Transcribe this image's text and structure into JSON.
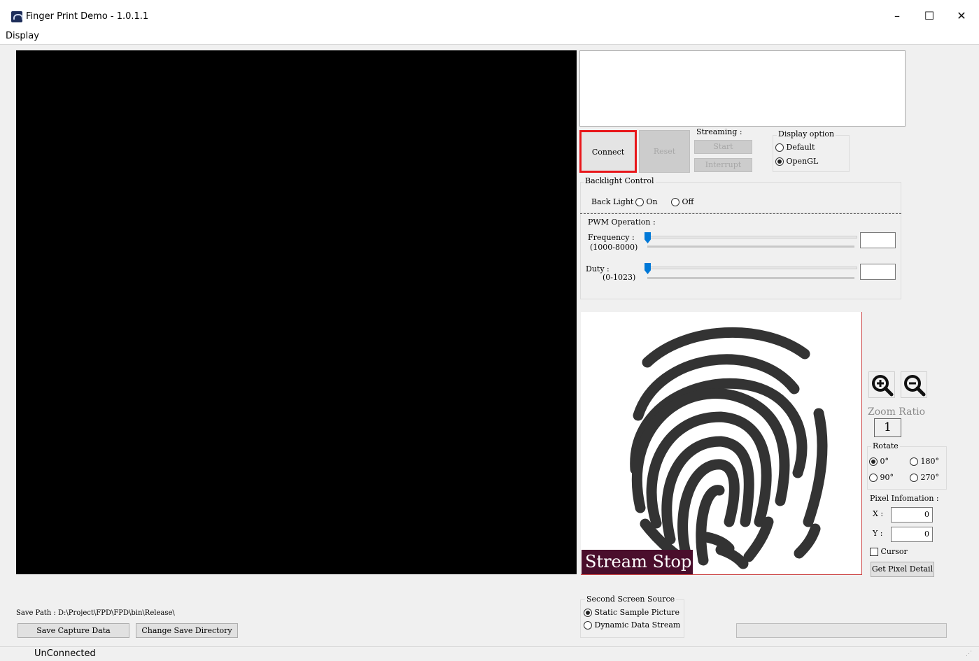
{
  "window": {
    "title": "Finger Print Demo - 1.0.1.1",
    "controls": {
      "minimize": "–",
      "maximize": "☐",
      "close": "✕"
    }
  },
  "menu": {
    "items": [
      {
        "label": "Display"
      }
    ]
  },
  "connection": {
    "connect_label": "Connect",
    "reset_label": "Reset",
    "streaming_label": "Streaming :",
    "start_label": "Start",
    "interrupt_label": "Interrupt"
  },
  "display_option": {
    "title": "Display option",
    "options": [
      {
        "label": "Default",
        "selected": false
      },
      {
        "label": "OpenGL",
        "selected": true
      }
    ]
  },
  "backlight": {
    "title": "Backlight Control",
    "label": "Back Light :",
    "options": [
      {
        "label": "On",
        "selected": false
      },
      {
        "label": "Off",
        "selected": false
      }
    ]
  },
  "pwm": {
    "title": "PWM Operation :",
    "frequency_label": "Frequency :",
    "frequency_range": "(1000-8000)",
    "duty_label": "Duty :",
    "duty_range": "(0-1023)",
    "frequency_level": 0,
    "duty_level": 0
  },
  "preview": {
    "overlay_text": "Stream Stop"
  },
  "zoom": {
    "zoom_in_icon": "zoom-in-icon",
    "zoom_out_icon": "zoom-out-icon",
    "ratio_label": "Zoom Ratio",
    "ratio_value": "1"
  },
  "rotate": {
    "title": "Rotate",
    "options": [
      {
        "label": "0°",
        "selected": true
      },
      {
        "label": "180°",
        "selected": false
      },
      {
        "label": "90°",
        "selected": false
      },
      {
        "label": "270°",
        "selected": false
      }
    ]
  },
  "pixel_info": {
    "title": "Pixel Infomation :",
    "x_label": "X :",
    "x_value": "0",
    "y_label": "Y :",
    "y_value": "0",
    "cursor_label": "Cursor",
    "cursor_checked": false,
    "detail_button": "Get Pixel Detail"
  },
  "second_screen": {
    "title": "Second Screen Source",
    "options": [
      {
        "label": "Static Sample Picture",
        "selected": true
      },
      {
        "label": "Dynamic Data Stream",
        "selected": false
      }
    ]
  },
  "save": {
    "path_text": "Save Path : D:\\Project\\FPD\\FPD\\bin\\Release\\",
    "capture_button": "Save Capture Data",
    "change_dir_button": "Change Save Directory"
  },
  "status": {
    "text": "UnConnected"
  }
}
